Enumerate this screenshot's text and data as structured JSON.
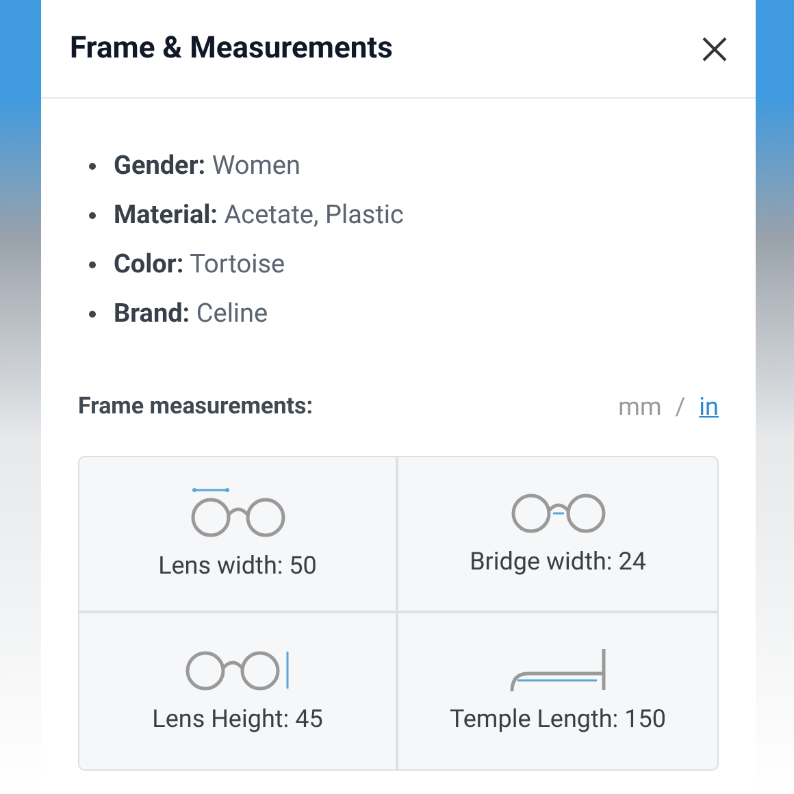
{
  "dialog": {
    "title": "Frame & Measurements"
  },
  "attributes": [
    {
      "label": "Gender:",
      "value": "Women"
    },
    {
      "label": "Material:",
      "value": "Acetate, Plastic"
    },
    {
      "label": "Color:",
      "value": "Tortoise"
    },
    {
      "label": "Brand:",
      "value": "Celine"
    }
  ],
  "measurements": {
    "heading": "Frame measurements:",
    "separator": "/",
    "units": [
      {
        "label": "mm",
        "selected": true
      },
      {
        "label": "in",
        "selected": false
      }
    ],
    "cells": [
      {
        "kind": "lens_width",
        "label": "Lens width: 50"
      },
      {
        "kind": "bridge_width",
        "label": "Bridge width: 24"
      },
      {
        "kind": "lens_height",
        "label": "Lens Height: 45"
      },
      {
        "kind": "temple_length",
        "label": "Temple Length: 150"
      }
    ]
  }
}
